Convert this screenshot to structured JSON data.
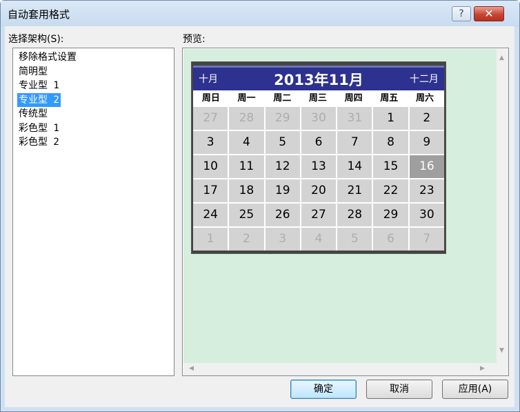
{
  "window": {
    "title": "自动套用格式",
    "help_glyph": "?",
    "close_glyph": "✕"
  },
  "labels": {
    "framework": "选择架构(S):",
    "preview": "预览:"
  },
  "framework_list": {
    "items": [
      "移除格式设置",
      "简明型",
      "专业型 1",
      "专业型 2",
      "传统型",
      "彩色型 1",
      "彩色型 2"
    ],
    "selected_index": 3
  },
  "calendar": {
    "prev_label": "十月",
    "title": "2013年11月",
    "next_label": "十二月",
    "weekdays": [
      "周日",
      "周一",
      "周二",
      "周三",
      "周四",
      "周五",
      "周六"
    ],
    "days": [
      "27",
      "28",
      "29",
      "30",
      "31",
      "1",
      "2",
      "3",
      "4",
      "5",
      "6",
      "7",
      "8",
      "9",
      "10",
      "11",
      "12",
      "13",
      "14",
      "15",
      "16",
      "17",
      "18",
      "19",
      "20",
      "21",
      "22",
      "23",
      "24",
      "25",
      "26",
      "27",
      "28",
      "29",
      "30",
      "1",
      "2",
      "3",
      "4",
      "5",
      "6",
      "7"
    ],
    "other_month_indices": [
      0,
      1,
      2,
      3,
      4,
      35,
      36,
      37,
      38,
      39,
      40,
      41
    ],
    "today_index": 20
  },
  "buttons": {
    "ok": "确定",
    "cancel": "取消",
    "apply": "应用(A)"
  },
  "colors": {
    "selection": "#3399ff",
    "preview_background": "#d6eedd",
    "calendar_header": "#2d318f"
  }
}
